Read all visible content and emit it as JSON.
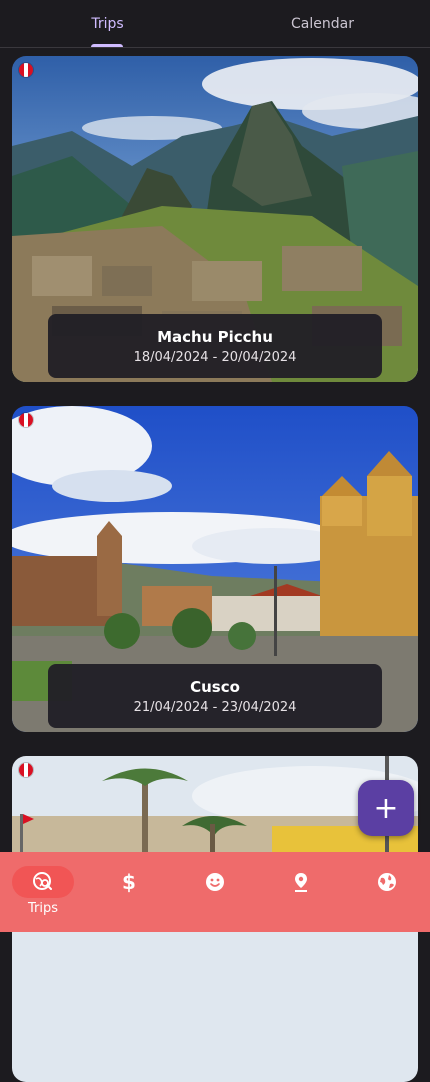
{
  "tabs": [
    {
      "label": "Trips",
      "active": true
    },
    {
      "label": "Calendar",
      "active": false
    }
  ],
  "trips": [
    {
      "title": "Machu Picchu",
      "dates": "18/04/2024 - 20/04/2024",
      "flag": "peru-flag-icon"
    },
    {
      "title": "Cusco",
      "dates": "21/04/2024 - 23/04/2024",
      "flag": "peru-flag-icon"
    },
    {
      "title": "",
      "dates": "",
      "flag": "peru-flag-icon"
    }
  ],
  "fab": {
    "icon": "plus-icon",
    "symbol": "+"
  },
  "bottom_nav": {
    "items": [
      {
        "icon": "trips-globe-search-icon",
        "label": "Trips",
        "active": true
      },
      {
        "icon": "dollar-icon",
        "label": ""
      },
      {
        "icon": "emoji-icon",
        "label": ""
      },
      {
        "icon": "map-pin-icon",
        "label": ""
      },
      {
        "icon": "globe-icon",
        "label": ""
      }
    ]
  },
  "colors": {
    "background": "#1c1b1f",
    "tab_accent": "#d0bcff",
    "fab": "#5b3fa3",
    "bottom_nav": "#ef6b6b",
    "nav_active_pill": "#f15555",
    "flag_red": "#d91023"
  }
}
